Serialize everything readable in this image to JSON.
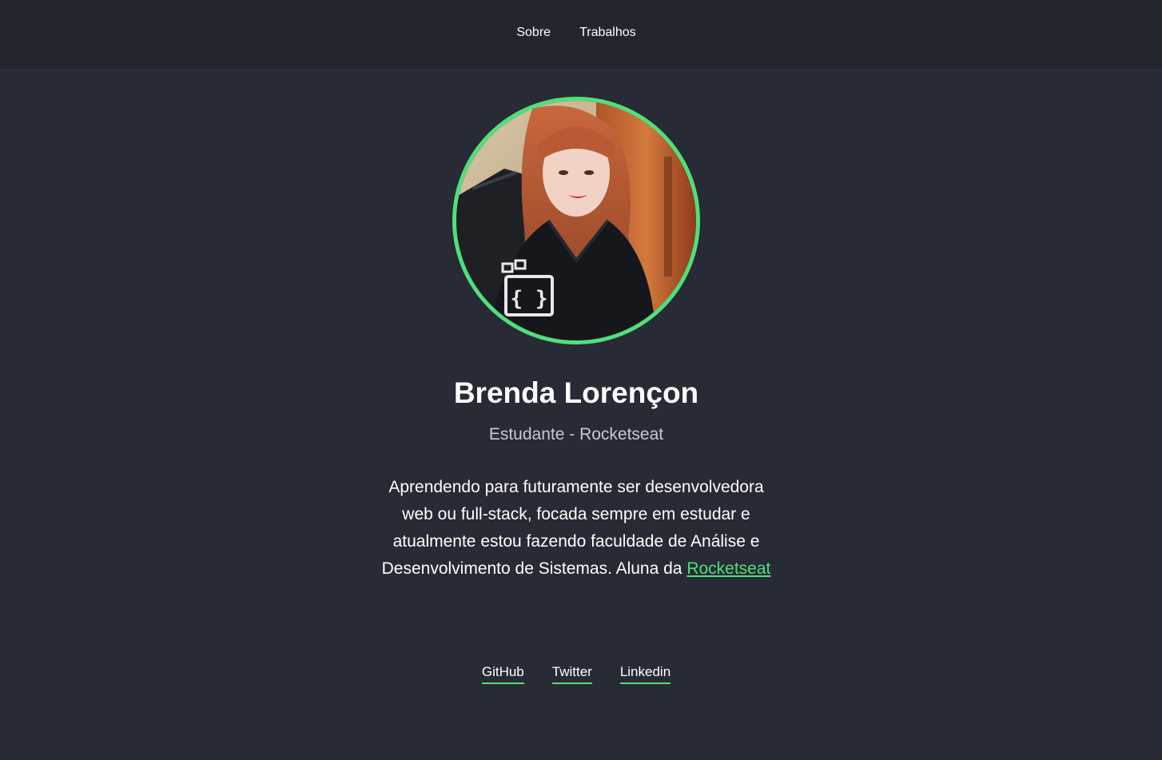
{
  "nav": {
    "items": [
      {
        "label": "Sobre"
      },
      {
        "label": "Trabalhos"
      }
    ]
  },
  "profile": {
    "name": "Brenda Lorençon",
    "role": "Estudante - Rocketseat",
    "bio_text": "Aprendendo para futuramente ser desenvolvedora web ou full-stack, focada sempre em estudar e atualmente estou fazendo faculdade de Análise e Desenvolvimento de Sistemas. Aluna da ",
    "bio_link": "Rocketseat",
    "avatar_icon": "profile-photo",
    "accent_color": "#4fe07a"
  },
  "social": {
    "links": [
      {
        "label": "GitHub"
      },
      {
        "label": "Twitter"
      },
      {
        "label": "Linkedin"
      }
    ]
  },
  "colors": {
    "background": "#282a35",
    "topbar": "#23252f",
    "accent": "#4fe07a"
  }
}
